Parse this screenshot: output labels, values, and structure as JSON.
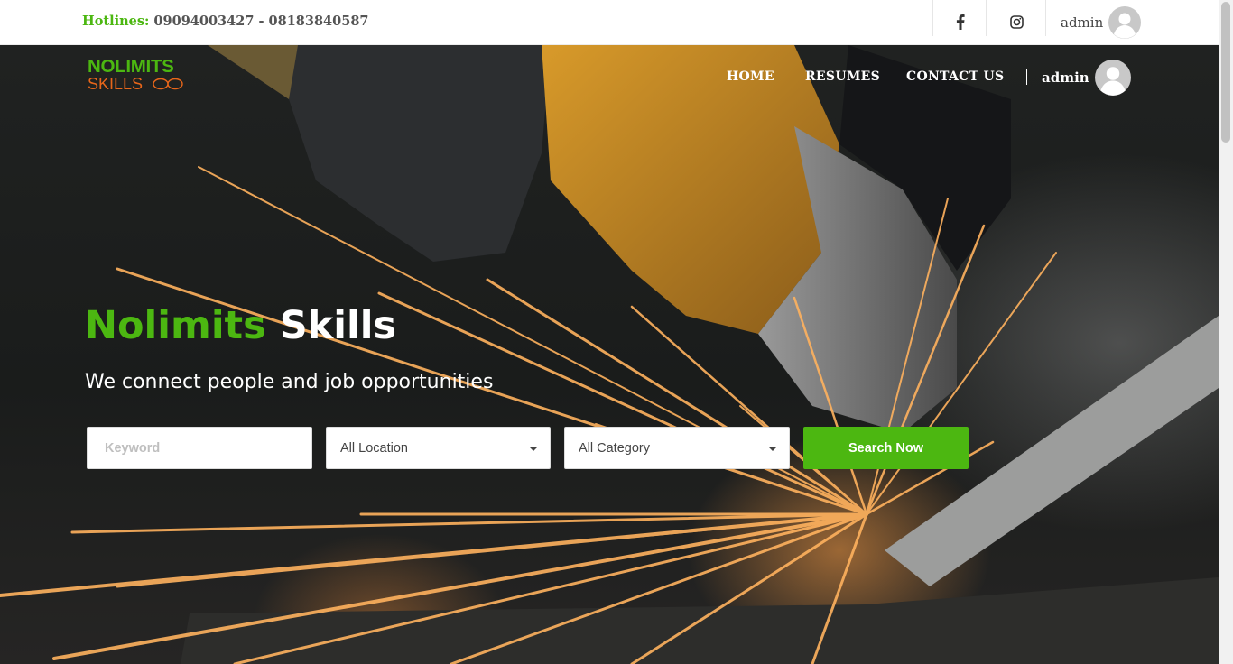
{
  "topbar": {
    "hotline_label": "Hotlines:",
    "hotline_numbers": " 09094003427 - 08183840587",
    "user_name": "admin",
    "icons": [
      "facebook-icon",
      "instagram-icon",
      "avatar"
    ]
  },
  "logo": {
    "line1": "NOLIMITS",
    "line2": "SKILLS"
  },
  "nav": {
    "items": [
      {
        "label": "HOME"
      },
      {
        "label": "RESUMES"
      },
      {
        "label": "CONTACT US"
      }
    ],
    "user_name": "admin"
  },
  "hero": {
    "title_green": "Nolimits",
    "title_white": "Skills",
    "subtitle": "We connect people and job opportunities"
  },
  "search": {
    "keyword_placeholder": "Keyword",
    "location_selected": "All Location",
    "category_selected": "All Category",
    "button_label": "Search Now"
  },
  "colors": {
    "brand_green": "#4cb711",
    "brand_orange": "#e8661a",
    "text_dark": "#444444"
  }
}
